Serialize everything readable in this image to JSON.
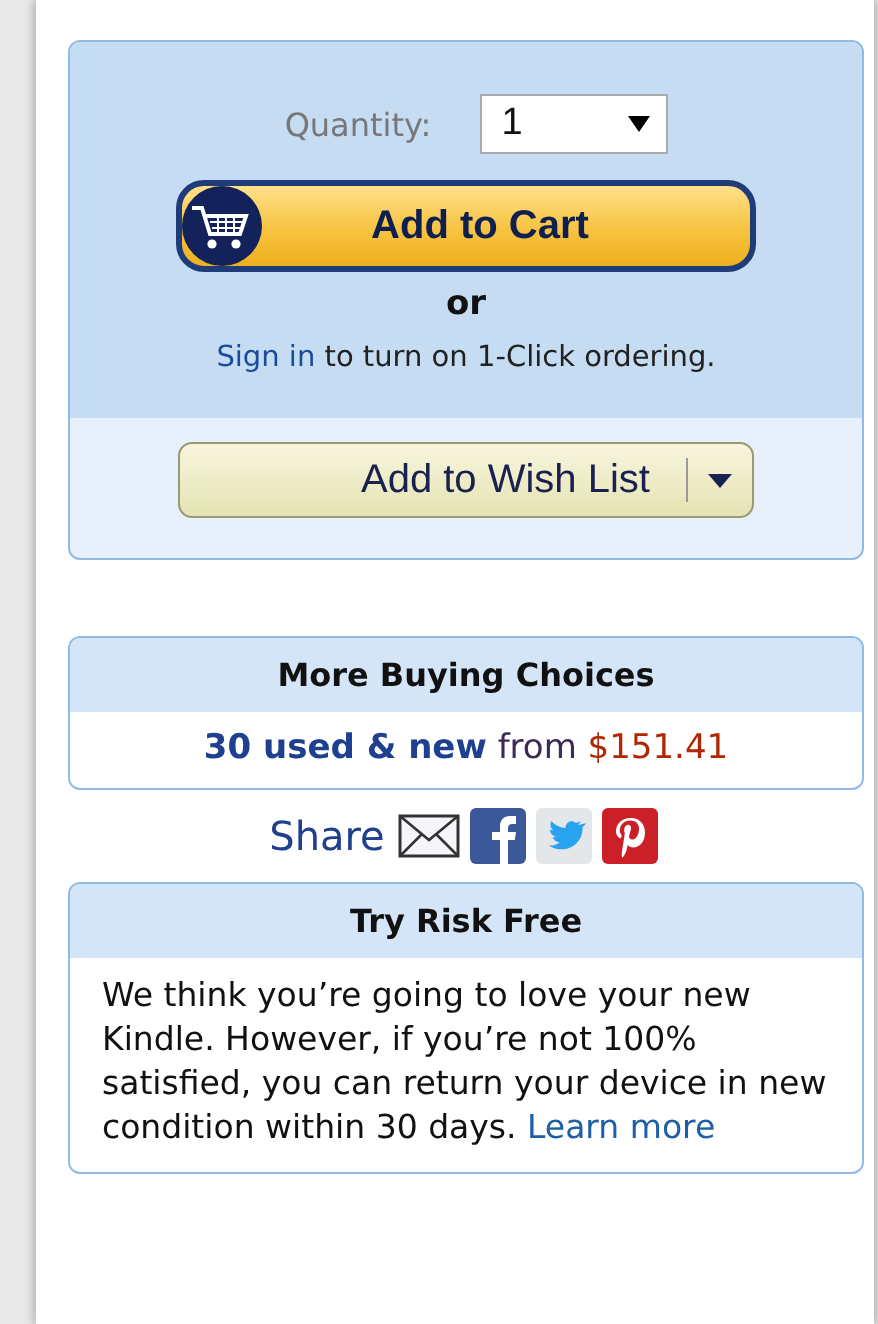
{
  "buy_box": {
    "quantity_label": "Quantity:",
    "quantity_value": "1",
    "add_to_cart": "Add to Cart",
    "or": "or",
    "sign_in": {
      "link": "Sign in",
      "text": "to turn on 1-Click ordering."
    },
    "add_to_wish_list": "Add to Wish List"
  },
  "more_buying_choices": {
    "title": "More Buying Choices",
    "offers_link": "30 used & new",
    "from": "from",
    "price": "$151.41"
  },
  "share": {
    "label": "Share"
  },
  "try_risk_free": {
    "title": "Try Risk Free",
    "text": "We think you’re going to love your new Kindle. However, if you’re not 100% satisfied, you can return your device in new condition within 30 days.",
    "link": "Learn more"
  }
}
